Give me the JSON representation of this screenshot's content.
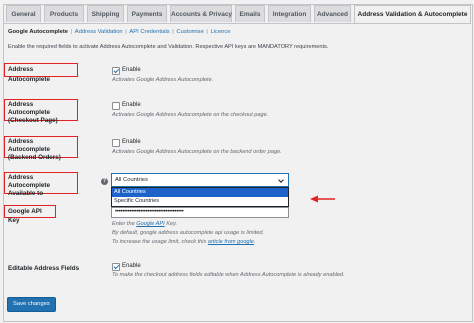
{
  "tabs": [
    {
      "label": "General"
    },
    {
      "label": "Products"
    },
    {
      "label": "Shipping"
    },
    {
      "label": "Payments"
    },
    {
      "label": "Accounts & Privacy"
    },
    {
      "label": "Emails"
    },
    {
      "label": "Integration"
    },
    {
      "label": "Advanced"
    },
    {
      "label": "Address Validation & Autocomplete"
    }
  ],
  "subnav": {
    "current": "Google Autocomplete",
    "links": [
      "Address Validation",
      "API Credentials",
      "Customise",
      "Licence"
    ]
  },
  "intro": "Enable the required fields to activate Address Autocomplete and Validation. Respective API keys are MANDATORY requirements.",
  "fields": {
    "autocomplete": {
      "label": "Address Autocomplete",
      "checkbox_label": "Enable",
      "checked": true,
      "desc": "Activates Google Address Autocomplete."
    },
    "checkout": {
      "label_line1": "Address Autocomplete",
      "label_line2": "(Checkout Page)",
      "checkbox_label": "Enable",
      "checked": false,
      "desc": "Activates Google Address Autocomplete on the checkout page."
    },
    "backend": {
      "label_line1": "Address Autocomplete",
      "label_line2": "(Backend Orders)",
      "checkbox_label": "Enable",
      "checked": false,
      "desc": "Activates Google Address Autocomplete on the backend order page."
    },
    "available_to": {
      "label_line1": "Address Autocomplete",
      "label_line2": "Available to",
      "help_icon": "question-icon",
      "selected": "All Countries",
      "options": [
        "All Countries",
        "Specific Countries"
      ]
    },
    "api_key": {
      "label": "Google API Key",
      "value": "••••••••••••••••••••••••••••••••••••••",
      "note_prefix": "Enter the",
      "note_link": "Google API",
      "note_suffix": "Key.",
      "note2": "By default, google address autocomplete api usage is limited.",
      "note3_prefix": "To increase the usage limit, check this",
      "note3_link": "article from google",
      "note3_suffix": "."
    },
    "editable": {
      "label": "Editable Address Fields",
      "checkbox_label": "Enable",
      "checked": true,
      "desc": "To make the checkout address fields editable when Address Autocomplete is already enabled."
    }
  },
  "save_label": "Save changes",
  "colors": {
    "accent": "#2271b1",
    "highlight": "#e02424",
    "selected_option": "#1e63c9"
  }
}
